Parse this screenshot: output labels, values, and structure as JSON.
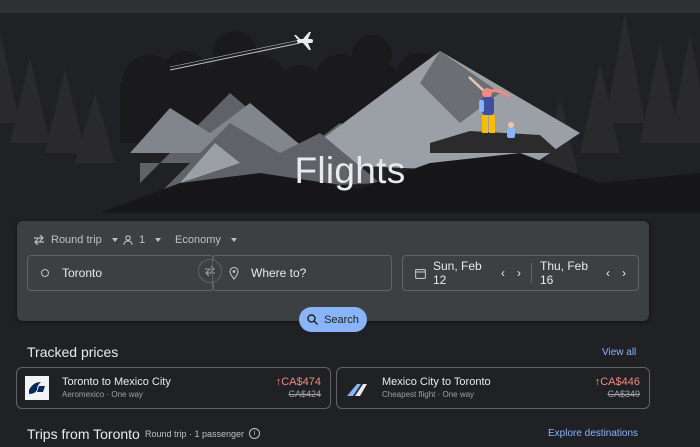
{
  "page": {
    "title": "Flights"
  },
  "search": {
    "trip_type": "Round trip",
    "passengers": "1",
    "cabin_class": "Economy",
    "origin": "Toronto",
    "destination_placeholder": "Where to?",
    "depart_date": "Sun, Feb 12",
    "return_date": "Thu, Feb 16",
    "search_label": "Search"
  },
  "tracked": {
    "title": "Tracked prices",
    "view_all": "View all",
    "items": [
      {
        "route": "Toronto to Mexico City",
        "sub": "Aeromexico · One way",
        "price": "CA$474",
        "old_price": "CA$424",
        "logo": "aeromexico-logo"
      },
      {
        "route": "Mexico City to Toronto",
        "sub": "Cheapest flight · One way",
        "price": "CA$446",
        "old_price": "CA$349",
        "logo": "plane-tail-logo"
      }
    ]
  },
  "trips": {
    "title": "Trips from Toronto",
    "meta": "Round trip · 1 passenger",
    "explore": "Explore destinations"
  },
  "colors": {
    "accent": "#8ab4f8",
    "price_up": "#f28b82",
    "background": "#202124",
    "panel": "#3c4043"
  }
}
